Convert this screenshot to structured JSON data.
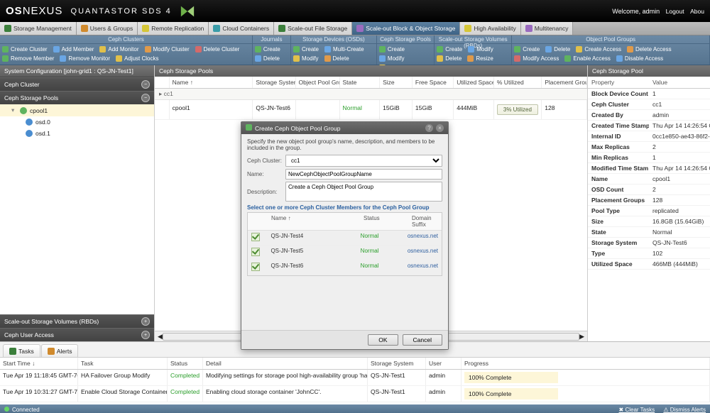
{
  "brand": {
    "pre": "OS",
    "mid": "NEXUS",
    "suite": "QUANTASTOR SDS 4"
  },
  "usermenu": {
    "welcome": "Welcome, admin",
    "logout": "Logout",
    "about": "Abou"
  },
  "navtabs": [
    {
      "label": "Storage Management"
    },
    {
      "label": "Users & Groups"
    },
    {
      "label": "Remote Replication"
    },
    {
      "label": "Cloud Containers"
    },
    {
      "label": "Scale-out File Storage"
    },
    {
      "label": "Scale-out Block & Object Storage"
    },
    {
      "label": "High Availability"
    },
    {
      "label": "Multitenancy"
    }
  ],
  "navactive": 5,
  "ribbon": [
    {
      "title": "Ceph Clusters",
      "items": [
        "Create Cluster",
        "Add Member",
        "Add Monitor",
        "Modify Cluster",
        "Delete Cluster",
        "Remove Member",
        "Remove Monitor",
        "Adjust Clocks"
      ]
    },
    {
      "title": "Journals",
      "items": [
        "Create",
        "Delete"
      ]
    },
    {
      "title": "Storage Devices (OSDs)",
      "items": [
        "Create",
        "Multi-Create",
        "Modify",
        "Delete"
      ]
    },
    {
      "title": "Ceph Storage Pools",
      "items": [
        "Create",
        "Modify",
        "Delete"
      ]
    },
    {
      "title": "Scale-out Storage Volumes (RBDs)",
      "items": [
        "Create",
        "Modify",
        "Delete",
        "Resize"
      ]
    },
    {
      "title": "Object Pool Groups",
      "items": [
        "Create",
        "Delete",
        "Create Access",
        "Delete Access",
        "Modify Access",
        "Enable Access",
        "Disable Access"
      ]
    }
  ],
  "leftheader": "System Configuration [john-grid1 : QS-JN-Test1]",
  "leftaccordion": [
    "Ceph Cluster",
    "Ceph Storage Pools",
    "Scale-out Storage Volumes (RBDs)",
    "Ceph User Access"
  ],
  "tree": {
    "pool": "cpool1",
    "osds": [
      "osd.0",
      "osd.1"
    ]
  },
  "grid": {
    "title": "Ceph Storage Pools",
    "columns": [
      "",
      "Name ↑",
      "Storage System",
      "Object Pool Group",
      "State",
      "Size",
      "Free Space",
      "Utilized Space",
      "% Utilized",
      "Placement Groups"
    ],
    "group": "cc1",
    "row": {
      "name": "cpool1",
      "ss": "QS-JN-Test6",
      "opg": "",
      "state": "Normal",
      "size": "15GiB",
      "free": "15GiB",
      "used": "444MiB",
      "pct": "3% Utilized",
      "pg": "128"
    }
  },
  "modal": {
    "title": "Create Ceph Object Pool Group",
    "desc": "Specify the new object pool group's name, description, and members to be included in the group.",
    "lbl_cluster": "Ceph Cluster:",
    "lbl_name": "Name:",
    "lbl_desc": "Description:",
    "cluster": "cc1",
    "name": "NewCephObjectPoolGroupName",
    "descr": "Create a Ceph Object Pool Group",
    "sect": "Select one or more Ceph Cluster Members for the Ceph Pool Group",
    "cols": [
      "",
      "Name ↑",
      "Status",
      "Domain Suffix"
    ],
    "rows": [
      {
        "name": "QS-JN-Test4",
        "status": "Normal",
        "domain": "osnexus.net"
      },
      {
        "name": "QS-JN-Test5",
        "status": "Normal",
        "domain": "osnexus.net"
      },
      {
        "name": "QS-JN-Test6",
        "status": "Normal",
        "domain": "osnexus.net"
      }
    ],
    "ok": "OK",
    "cancel": "Cancel"
  },
  "rightpanel": {
    "title": "Ceph Storage Pool",
    "cols": [
      "Property",
      "Value"
    ],
    "rows": [
      [
        "Block Device Count",
        "1"
      ],
      [
        "Ceph Cluster",
        "cc1"
      ],
      [
        "Created By",
        "admin"
      ],
      [
        "Created Time Stamp",
        "Thu Apr 14 14:26:54 GMT-7"
      ],
      [
        "Internal ID",
        "0cc1e850-ae43-86f2-2286-"
      ],
      [
        "Max Replicas",
        "2"
      ],
      [
        "Min Replicas",
        "1"
      ],
      [
        "Modified Time Stam",
        "Thu Apr 14 14:26:54 GMT-7"
      ],
      [
        "Name",
        "cpool1"
      ],
      [
        "OSD Count",
        "2"
      ],
      [
        "Placement Groups",
        "128"
      ],
      [
        "Pool Type",
        "replicated"
      ],
      [
        "Size",
        "16.8GB (15.64GiB)"
      ],
      [
        "State",
        "Normal"
      ],
      [
        "Storage System",
        "QS-JN-Test6"
      ],
      [
        "Type",
        "102"
      ],
      [
        "Utilized Space",
        "466MB (444MiB)"
      ]
    ],
    "redidx": 13
  },
  "tasks": {
    "tabs": [
      "Tasks",
      "Alerts"
    ],
    "columns": [
      "Start Time ↓",
      "Task",
      "Status",
      "Detail",
      "Storage System",
      "User",
      "Progress"
    ],
    "rows": [
      {
        "time": "Tue Apr 19 11:18:45 GMT-700 …",
        "task": "HA Failover Group Modify",
        "status": "Completed",
        "detail": "Modifying settings for storage pool high-availability group 'ha-pool-ha-…",
        "ss": "QS-JN-Test1",
        "user": "admin",
        "prog": "100% Complete"
      },
      {
        "time": "Tue Apr 19 10:31:27 GMT-700 …",
        "task": "Enable Cloud Storage Container",
        "status": "Completed",
        "detail": "Enabling cloud storage container 'JohnCC'.",
        "ss": "QS-JN-Test1",
        "user": "admin",
        "prog": "100% Complete"
      }
    ]
  },
  "status": {
    "conn": "Connected",
    "clear": "Clear Tasks",
    "dismiss": "Dismiss Alerts"
  }
}
